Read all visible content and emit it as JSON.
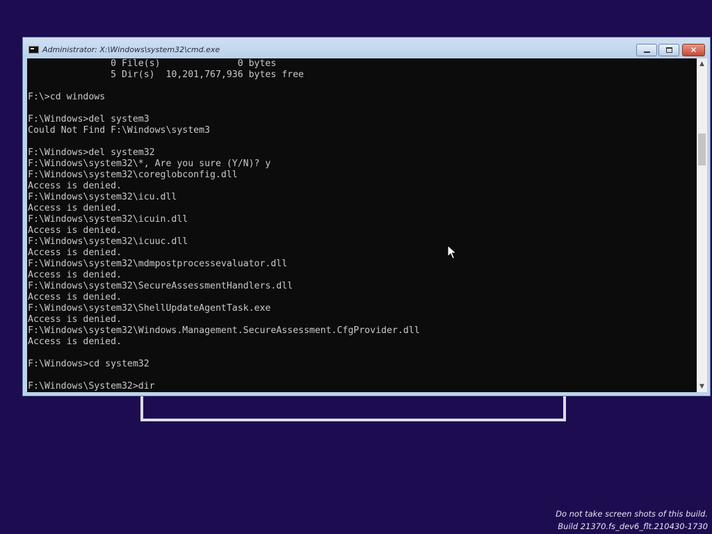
{
  "window": {
    "title": "Administrator: X:\\Windows\\system32\\cmd.exe",
    "close_glyph": "✕"
  },
  "console": {
    "lines": [
      "               0 File(s)              0 bytes",
      "               5 Dir(s)  10,201,767,936 bytes free",
      "",
      "F:\\>cd windows",
      "",
      "F:\\Windows>del system3",
      "Could Not Find F:\\Windows\\system3",
      "",
      "F:\\Windows>del system32",
      "F:\\Windows\\system32\\*, Are you sure (Y/N)? y",
      "F:\\Windows\\system32\\coreglobconfig.dll",
      "Access is denied.",
      "F:\\Windows\\system32\\icu.dll",
      "Access is denied.",
      "F:\\Windows\\system32\\icuin.dll",
      "Access is denied.",
      "F:\\Windows\\system32\\icuuc.dll",
      "Access is denied.",
      "F:\\Windows\\system32\\mdmpostprocessevaluator.dll",
      "Access is denied.",
      "F:\\Windows\\system32\\SecureAssessmentHandlers.dll",
      "Access is denied.",
      "F:\\Windows\\system32\\ShellUpdateAgentTask.exe",
      "Access is denied.",
      "F:\\Windows\\system32\\Windows.Management.SecureAssessment.CfgProvider.dll",
      "Access is denied.",
      "",
      "F:\\Windows>cd system32",
      "",
      "F:\\Windows\\System32>dir"
    ]
  },
  "scrollbar": {
    "up_glyph": "▲",
    "down_glyph": "▼"
  },
  "watermark": {
    "line1": "Do not take screen shots of this build.",
    "line2": "Build 21370.fs_dev6_flt.210430-1730"
  },
  "colors": {
    "desktop_background": "#1d0c50",
    "console_background": "#0c0c0c",
    "console_text": "#c9c9c9",
    "titlebar": "#bcd3ec",
    "close_button": "#c24a33"
  }
}
